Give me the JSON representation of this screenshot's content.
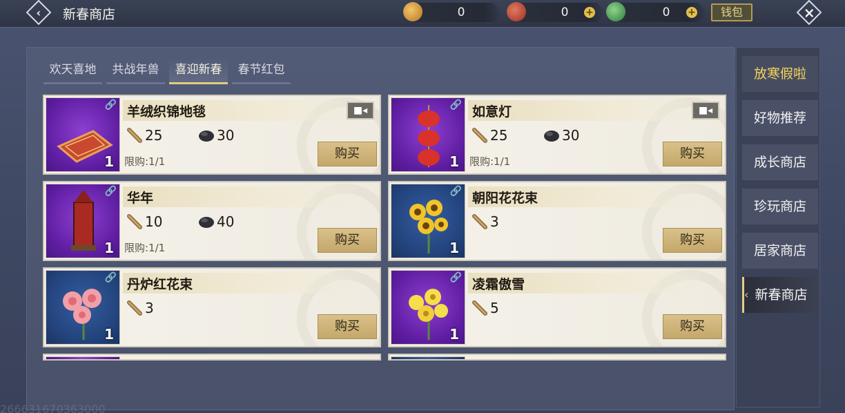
{
  "header": {
    "title": "新春商店",
    "currencies": [
      {
        "name": "gold-coin",
        "value": "0",
        "color": "#d9a24a",
        "has_plus": false
      },
      {
        "name": "red-token",
        "value": "0",
        "color": "#c0483a",
        "has_plus": true
      },
      {
        "name": "jade-token",
        "value": "0",
        "color": "#3e9a5a",
        "has_plus": true
      }
    ],
    "wallet_label": "钱包"
  },
  "tabs": [
    {
      "label": "欢天喜地",
      "active": false
    },
    {
      "label": "共战年兽",
      "active": false
    },
    {
      "label": "喜迎新春",
      "active": true
    },
    {
      "label": "春节红包",
      "active": false
    }
  ],
  "items": [
    {
      "name": "羊绒织锦地毯",
      "qty": "1",
      "thumb": "purple",
      "icon": "carpet-icon",
      "costs": [
        {
          "icon": "scroll-icon",
          "value": "25"
        },
        {
          "icon": "fur-icon",
          "value": "30"
        }
      ],
      "limit": "限购:1/1",
      "camera": true,
      "buy": "购买"
    },
    {
      "name": "如意灯",
      "qty": "1",
      "thumb": "purple",
      "icon": "lantern-icon",
      "costs": [
        {
          "icon": "scroll-icon",
          "value": "25"
        },
        {
          "icon": "fur-icon",
          "value": "30"
        }
      ],
      "limit": "限购:1/1",
      "camera": true,
      "buy": "购买"
    },
    {
      "name": "华年",
      "qty": "1",
      "thumb": "purple",
      "icon": "firecracker-icon",
      "costs": [
        {
          "icon": "scroll-icon",
          "value": "10"
        },
        {
          "icon": "fur-icon",
          "value": "40"
        }
      ],
      "limit": "限购:1/1",
      "camera": false,
      "buy": "购买"
    },
    {
      "name": "朝阳花花束",
      "qty": "1",
      "thumb": "blue",
      "icon": "sunflower-icon",
      "costs": [
        {
          "icon": "scroll-icon",
          "value": "3"
        }
      ],
      "limit": "",
      "camera": false,
      "buy": "购买"
    },
    {
      "name": "丹炉红花束",
      "qty": "1",
      "thumb": "blue",
      "icon": "peony-icon",
      "costs": [
        {
          "icon": "scroll-icon",
          "value": "3"
        }
      ],
      "limit": "",
      "camera": false,
      "buy": "购买"
    },
    {
      "name": "凌霜傲雪",
      "qty": "1",
      "thumb": "purple",
      "icon": "yellow-flower-icon",
      "costs": [
        {
          "icon": "scroll-icon",
          "value": "5"
        }
      ],
      "limit": "",
      "camera": false,
      "buy": "购买"
    }
  ],
  "sidebar": {
    "items": [
      {
        "label": "放寒假啦",
        "state": "highlight"
      },
      {
        "label": "好物推荐",
        "state": "normal"
      },
      {
        "label": "成长商店",
        "state": "normal"
      },
      {
        "label": "珍玩商店",
        "state": "normal"
      },
      {
        "label": "居家商店",
        "state": "normal"
      },
      {
        "label": "新春商店",
        "state": "active"
      }
    ]
  },
  "footer": {
    "uid": "266631670363000"
  }
}
